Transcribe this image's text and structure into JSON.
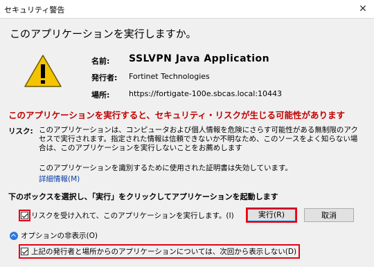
{
  "window": {
    "title": "セキュリティ警告",
    "close_glyph": "✕"
  },
  "header": {
    "title": "このアプリケーションを実行しますか。"
  },
  "info": {
    "name_label": "名前:",
    "name_value": "SSLVPN Java Application",
    "publisher_label": "発行者:",
    "publisher_value": "Fortinet Technologies",
    "location_label": "場所:",
    "location_value": "https://fortigate-100e.sbcas.local:10443"
  },
  "warning": {
    "text": "このアプリケーションを実行すると、セキュリティ・リスクが生じる可能性があります"
  },
  "risk": {
    "label": "リスク:",
    "text": "このアプリケーションは、コンピュータおよび個人情報を危険にさらす可能性がある無制限のアクセスで実行されます。指定された情報は信頼できないか不明なため、このソースをよく知らない場合は、このアプリケーションを実行しないことをお薦めします",
    "cert_text": "このアプリケーションを識別するために使用された証明書は失効しています。",
    "details_link": "詳細情報(M)"
  },
  "instruction": "下のボックスを選択し、「実行」をクリックしてアプリケーションを起動します",
  "accept_checkbox": {
    "label": "リスクを受け入れて、このアプリケーションを実行します。(I)",
    "checked": true
  },
  "buttons": {
    "run": "実行(R)",
    "cancel": "取消"
  },
  "options": {
    "label": "オプションの非表示(O)"
  },
  "dont_show_checkbox": {
    "label": "上記の発行者と場所からのアプリケーションについては、次回から表示しない(D)",
    "checked": true
  },
  "colors": {
    "warning_red": "#c00000",
    "highlight_red": "#e60012",
    "link_blue": "#0a3ea8"
  },
  "icons": {
    "warning": "warning-triangle-icon",
    "options": "chevron-up-circle-icon"
  }
}
